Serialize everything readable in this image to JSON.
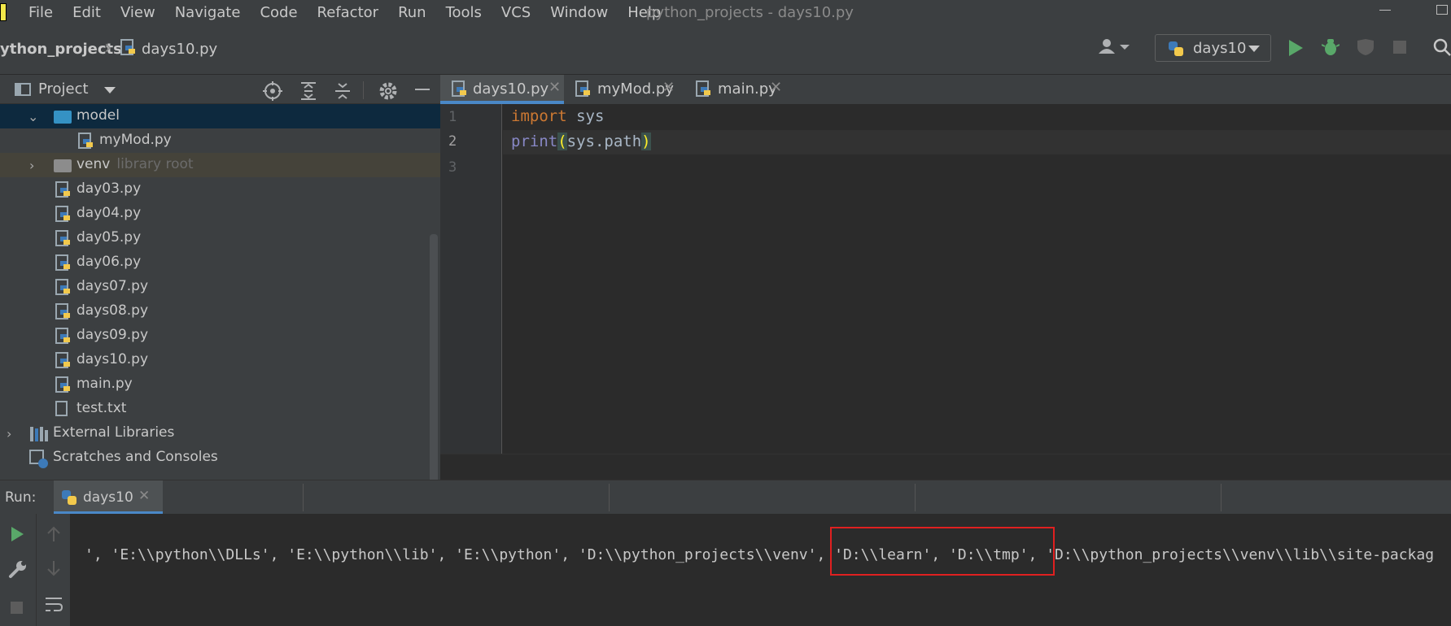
{
  "menubar": {
    "items": [
      "File",
      "Edit",
      "View",
      "Navigate",
      "Code",
      "Refactor",
      "Run",
      "Tools",
      "VCS",
      "Window",
      "Help"
    ],
    "window_title": "python_projects - days10.py"
  },
  "navbar": {
    "project": "ython_projects",
    "file": "days10.py",
    "run_config": "days10"
  },
  "project_panel": {
    "title": "Project",
    "tree": [
      {
        "label": "model",
        "hint": "",
        "type": "folder"
      },
      {
        "label": "myMod.py",
        "hint": "",
        "type": "py"
      },
      {
        "label": "venv",
        "hint": "library root",
        "type": "folder"
      },
      {
        "label": "day03.py",
        "hint": "",
        "type": "py"
      },
      {
        "label": "day04.py",
        "hint": "",
        "type": "py"
      },
      {
        "label": "day05.py",
        "hint": "",
        "type": "py"
      },
      {
        "label": "day06.py",
        "hint": "",
        "type": "py"
      },
      {
        "label": "days07.py",
        "hint": "",
        "type": "py"
      },
      {
        "label": "days08.py",
        "hint": "",
        "type": "py"
      },
      {
        "label": "days09.py",
        "hint": "",
        "type": "py"
      },
      {
        "label": "days10.py",
        "hint": "",
        "type": "py"
      },
      {
        "label": "main.py",
        "hint": "",
        "type": "py"
      },
      {
        "label": "test.txt",
        "hint": "",
        "type": "txt"
      },
      {
        "label": "External Libraries",
        "hint": "",
        "type": "lib"
      },
      {
        "label": "Scratches and Consoles",
        "hint": "",
        "type": "scratch"
      }
    ]
  },
  "editor": {
    "tabs": [
      {
        "label": "days10.py",
        "active": true
      },
      {
        "label": "myMod.py",
        "active": false
      },
      {
        "label": "main.py",
        "active": false
      }
    ],
    "line_numbers": [
      "1",
      "2",
      "3"
    ],
    "code": {
      "l1_kw": "import",
      "l1_rest": " sys",
      "l2_fn": "print",
      "l2_open": "(",
      "l2_mid": "sys.path",
      "l2_close": ")"
    }
  },
  "run_panel": {
    "label": "Run:",
    "tab": "days10",
    "output": "', 'E:\\\\python\\\\DLLs', 'E:\\\\python\\\\lib', 'E:\\\\python', 'D:\\\\python_projects\\\\venv', 'D:\\\\learn', 'D:\\\\tmp', 'D:\\\\python_projects\\\\venv\\\\lib\\\\site-packag"
  },
  "colors": {
    "accent": "#4a88c7",
    "run_green": "#59a869",
    "highlight_red": "#e02020"
  }
}
